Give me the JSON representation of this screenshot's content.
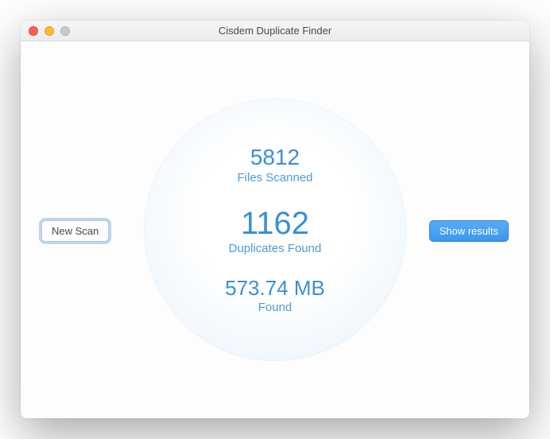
{
  "window": {
    "title": "Cisdem Duplicate Finder"
  },
  "buttons": {
    "new_scan": "New Scan",
    "show_results": "Show results"
  },
  "stats": {
    "files_scanned": {
      "value": "5812",
      "label": "Files Scanned"
    },
    "duplicates_found": {
      "value": "1162",
      "label": "Duplicates Found"
    },
    "size_found": {
      "value": "573.74 MB",
      "label": "Found"
    }
  }
}
